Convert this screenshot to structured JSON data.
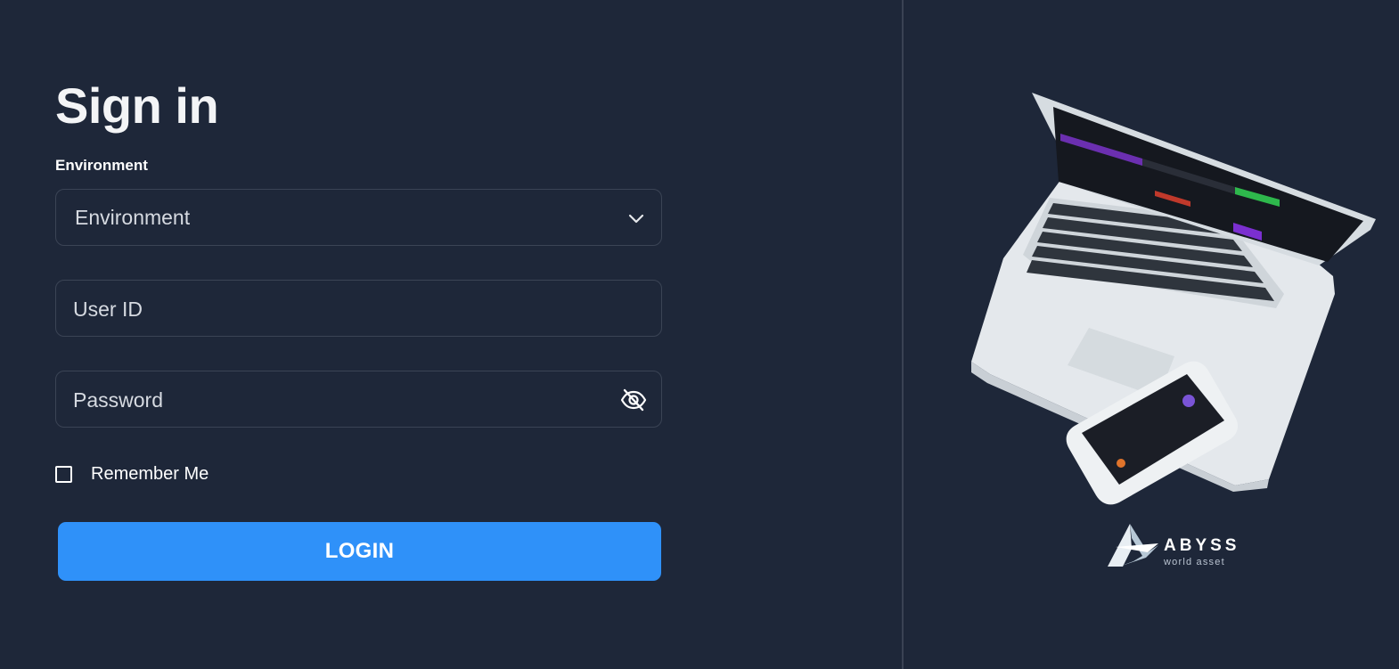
{
  "signin": {
    "title": "Sign in",
    "environment_label": "Environment",
    "environment_select_value": "Environment",
    "user_id_placeholder": "User ID",
    "password_placeholder": "Password",
    "remember_me_label": "Remember Me",
    "remember_me_checked": false,
    "login_button": "LOGIN"
  },
  "icons": {
    "environment_select": "chevron-down-icon",
    "password_toggle": "eye-off-icon"
  },
  "brand": {
    "name": "ABYSS",
    "tagline": "world asset"
  },
  "colors": {
    "background": "#1e2739",
    "primary_button": "#2f91f9",
    "field_border": "#3b4455"
  }
}
